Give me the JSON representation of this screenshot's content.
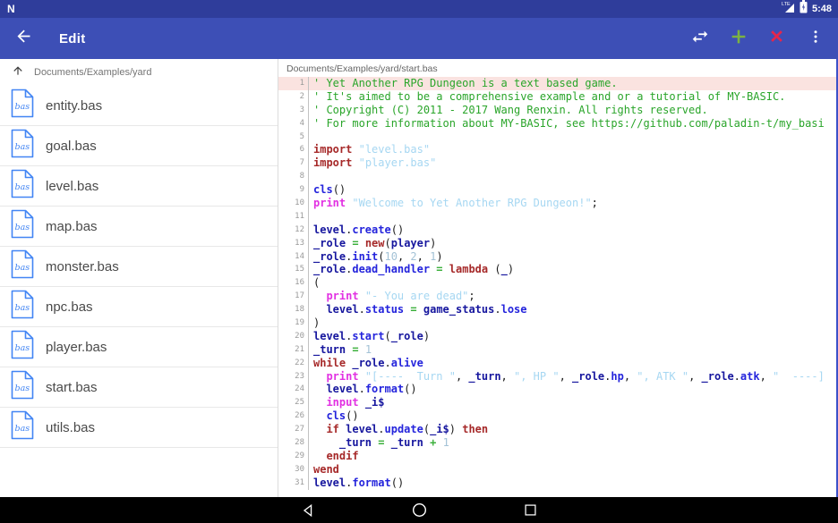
{
  "status_bar": {
    "notification": "N",
    "signal_label": "LTE",
    "time": "5:48"
  },
  "app_bar": {
    "title": "Edit",
    "back_label": "back",
    "actions": {
      "swap": "swap",
      "add": "add",
      "close": "close",
      "overflow": "more"
    }
  },
  "file_panel": {
    "path": "Documents/Examples/yard",
    "icon_label": "bas",
    "files": [
      "entity.bas",
      "goal.bas",
      "level.bas",
      "map.bas",
      "monster.bas",
      "npc.bas",
      "player.bas",
      "start.bas",
      "utils.bas"
    ]
  },
  "editor": {
    "path": "Documents/Examples/yard/start.bas",
    "lines": [
      {
        "n": 1,
        "hl": true,
        "seg": [
          [
            "cm",
            "' Yet Another RPG Dungeon is a text based game."
          ]
        ]
      },
      {
        "n": 2,
        "seg": [
          [
            "cm",
            "' It's aimed to be a comprehensive example and or a tutorial of MY-BASIC."
          ]
        ]
      },
      {
        "n": 3,
        "seg": [
          [
            "cm",
            "' Copyright (C) 2011 - 2017 Wang Renxin. All rights reserved."
          ]
        ]
      },
      {
        "n": 4,
        "seg": [
          [
            "cm",
            "' For more information about MY-BASIC, see https://github.com/paladin-t/my_basi"
          ]
        ]
      },
      {
        "n": 5,
        "seg": []
      },
      {
        "n": 6,
        "seg": [
          [
            "kw",
            "import"
          ],
          [
            "pl",
            " "
          ],
          [
            "st",
            "\"level.bas\""
          ]
        ]
      },
      {
        "n": 7,
        "seg": [
          [
            "kw",
            "import"
          ],
          [
            "pl",
            " "
          ],
          [
            "st",
            "\"player.bas\""
          ]
        ]
      },
      {
        "n": 8,
        "seg": []
      },
      {
        "n": 9,
        "seg": [
          [
            "fn",
            "cls"
          ],
          [
            "pl",
            "()"
          ]
        ]
      },
      {
        "n": 10,
        "seg": [
          [
            "mg",
            "print"
          ],
          [
            "pl",
            " "
          ],
          [
            "st",
            "\"Welcome to Yet Another RPG Dungeon!\""
          ],
          [
            "pl",
            ";"
          ]
        ]
      },
      {
        "n": 11,
        "seg": []
      },
      {
        "n": 12,
        "seg": [
          [
            "id",
            "level"
          ],
          [
            "pl",
            "."
          ],
          [
            "fn",
            "create"
          ],
          [
            "pl",
            "()"
          ]
        ]
      },
      {
        "n": 13,
        "seg": [
          [
            "id",
            "_role"
          ],
          [
            "pl",
            " "
          ],
          [
            "op",
            "="
          ],
          [
            "pl",
            " "
          ],
          [
            "kw",
            "new"
          ],
          [
            "pl",
            "("
          ],
          [
            "id",
            "player"
          ],
          [
            "pl",
            ")"
          ]
        ]
      },
      {
        "n": 14,
        "seg": [
          [
            "id",
            "_role"
          ],
          [
            "pl",
            "."
          ],
          [
            "fn",
            "init"
          ],
          [
            "pl",
            "("
          ],
          [
            "nu",
            "10"
          ],
          [
            "pl",
            ", "
          ],
          [
            "nu",
            "2"
          ],
          [
            "pl",
            ", "
          ],
          [
            "nu",
            "1"
          ],
          [
            "pl",
            ")"
          ]
        ]
      },
      {
        "n": 15,
        "seg": [
          [
            "id",
            "_role"
          ],
          [
            "pl",
            "."
          ],
          [
            "fn",
            "dead_handler"
          ],
          [
            "pl",
            " "
          ],
          [
            "op",
            "="
          ],
          [
            "pl",
            " "
          ],
          [
            "kw",
            "lambda"
          ],
          [
            "pl",
            " ("
          ],
          [
            "id",
            "_"
          ],
          [
            "pl",
            ")"
          ]
        ]
      },
      {
        "n": 16,
        "seg": [
          [
            "pl",
            "("
          ]
        ]
      },
      {
        "n": 17,
        "seg": [
          [
            "pl",
            "  "
          ],
          [
            "mg",
            "print"
          ],
          [
            "pl",
            " "
          ],
          [
            "st",
            "\"- You are dead\""
          ],
          [
            "pl",
            ";"
          ]
        ]
      },
      {
        "n": 18,
        "seg": [
          [
            "pl",
            "  "
          ],
          [
            "id",
            "level"
          ],
          [
            "pl",
            "."
          ],
          [
            "fn",
            "status"
          ],
          [
            "pl",
            " "
          ],
          [
            "op",
            "="
          ],
          [
            "pl",
            " "
          ],
          [
            "id",
            "game_status"
          ],
          [
            "pl",
            "."
          ],
          [
            "fn",
            "lose"
          ]
        ]
      },
      {
        "n": 19,
        "seg": [
          [
            "pl",
            ")"
          ]
        ]
      },
      {
        "n": 20,
        "seg": [
          [
            "id",
            "level"
          ],
          [
            "pl",
            "."
          ],
          [
            "fn",
            "start"
          ],
          [
            "pl",
            "("
          ],
          [
            "id",
            "_role"
          ],
          [
            "pl",
            ")"
          ]
        ]
      },
      {
        "n": 21,
        "seg": [
          [
            "id",
            "_turn"
          ],
          [
            "pl",
            " "
          ],
          [
            "op",
            "="
          ],
          [
            "pl",
            " "
          ],
          [
            "nu",
            "1"
          ]
        ]
      },
      {
        "n": 22,
        "seg": [
          [
            "kw",
            "while"
          ],
          [
            "pl",
            " "
          ],
          [
            "id",
            "_role"
          ],
          [
            "pl",
            "."
          ],
          [
            "fn",
            "alive"
          ]
        ]
      },
      {
        "n": 23,
        "seg": [
          [
            "pl",
            "  "
          ],
          [
            "mg",
            "print"
          ],
          [
            "pl",
            " "
          ],
          [
            "st",
            "\"[----  Turn \""
          ],
          [
            "pl",
            ", "
          ],
          [
            "id",
            "_turn"
          ],
          [
            "pl",
            ", "
          ],
          [
            "st",
            "\", HP \""
          ],
          [
            "pl",
            ", "
          ],
          [
            "id",
            "_role"
          ],
          [
            "pl",
            "."
          ],
          [
            "fn",
            "hp"
          ],
          [
            "pl",
            ", "
          ],
          [
            "st",
            "\", ATK \""
          ],
          [
            "pl",
            ", "
          ],
          [
            "id",
            "_role"
          ],
          [
            "pl",
            "."
          ],
          [
            "fn",
            "atk"
          ],
          [
            "pl",
            ", "
          ],
          [
            "st",
            "\"  ----]"
          ]
        ]
      },
      {
        "n": 24,
        "seg": [
          [
            "pl",
            "  "
          ],
          [
            "id",
            "level"
          ],
          [
            "pl",
            "."
          ],
          [
            "fn",
            "format"
          ],
          [
            "pl",
            "()"
          ]
        ]
      },
      {
        "n": 25,
        "seg": [
          [
            "pl",
            "  "
          ],
          [
            "mg",
            "input"
          ],
          [
            "pl",
            " "
          ],
          [
            "id",
            "_i$"
          ]
        ]
      },
      {
        "n": 26,
        "seg": [
          [
            "pl",
            "  "
          ],
          [
            "fn",
            "cls"
          ],
          [
            "pl",
            "()"
          ]
        ]
      },
      {
        "n": 27,
        "seg": [
          [
            "pl",
            "  "
          ],
          [
            "kw",
            "if"
          ],
          [
            "pl",
            " "
          ],
          [
            "id",
            "level"
          ],
          [
            "pl",
            "."
          ],
          [
            "fn",
            "update"
          ],
          [
            "pl",
            "("
          ],
          [
            "id",
            "_i$"
          ],
          [
            "pl",
            ") "
          ],
          [
            "kw",
            "then"
          ]
        ]
      },
      {
        "n": 28,
        "seg": [
          [
            "pl",
            "    "
          ],
          [
            "id",
            "_turn"
          ],
          [
            "pl",
            " "
          ],
          [
            "op",
            "="
          ],
          [
            "pl",
            " "
          ],
          [
            "id",
            "_turn"
          ],
          [
            "pl",
            " "
          ],
          [
            "op",
            "+"
          ],
          [
            "pl",
            " "
          ],
          [
            "nu",
            "1"
          ]
        ]
      },
      {
        "n": 29,
        "seg": [
          [
            "pl",
            "  "
          ],
          [
            "kw",
            "endif"
          ]
        ]
      },
      {
        "n": 30,
        "seg": [
          [
            "kw",
            "wend"
          ]
        ]
      },
      {
        "n": 31,
        "seg": [
          [
            "id",
            "level"
          ],
          [
            "pl",
            "."
          ],
          [
            "fn",
            "format"
          ],
          [
            "pl",
            "()"
          ]
        ]
      }
    ]
  },
  "colors": {
    "status_bar_bg": "#2F3D9B",
    "app_bar_bg": "#3D4FB6",
    "add_icon": "#7CB342",
    "close_icon": "#E5264C",
    "file_icon": "#4285F4",
    "line_highlight": "#FAE3E0",
    "syntax": {
      "comment": "#2AA52A",
      "keyword": "#A62929",
      "print_input": "#E231E2",
      "member": "#2424DC",
      "identifier": "#16169E",
      "string": "#A6D7F2",
      "number": "#A3C2D6",
      "operator": "#3CB03C",
      "plain": "#1a1a1a"
    }
  }
}
